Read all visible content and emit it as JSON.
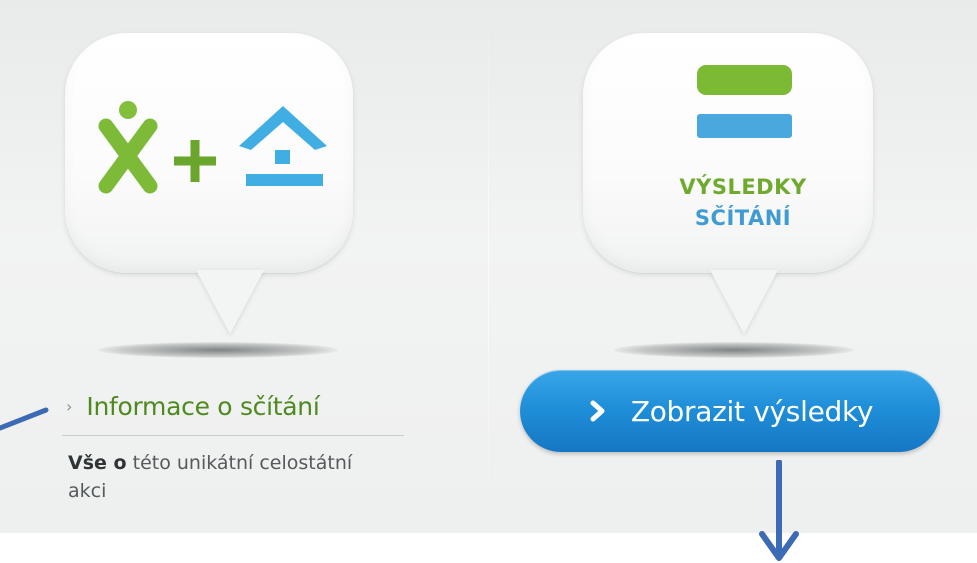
{
  "colors": {
    "green": "#6faa2e",
    "blue": "#3f9bd2",
    "button_blue": "#1f8fd9",
    "annotation_blue": "#3d6ab5"
  },
  "left_card": {
    "icon": "people-plus-house-logo",
    "link_label": "Informace o sčítání",
    "description_bold": "Vše o",
    "description_rest": "této unikátní celostátní akci"
  },
  "right_card": {
    "icon": "equals-stripes-logo",
    "title_line1": "VÝSLEDKY",
    "title_line2": "SČÍTÁNÍ",
    "button_label": "Zobrazit výsledky"
  },
  "annotations": [
    "pointer-arrow-left",
    "pointer-arrow-down"
  ]
}
